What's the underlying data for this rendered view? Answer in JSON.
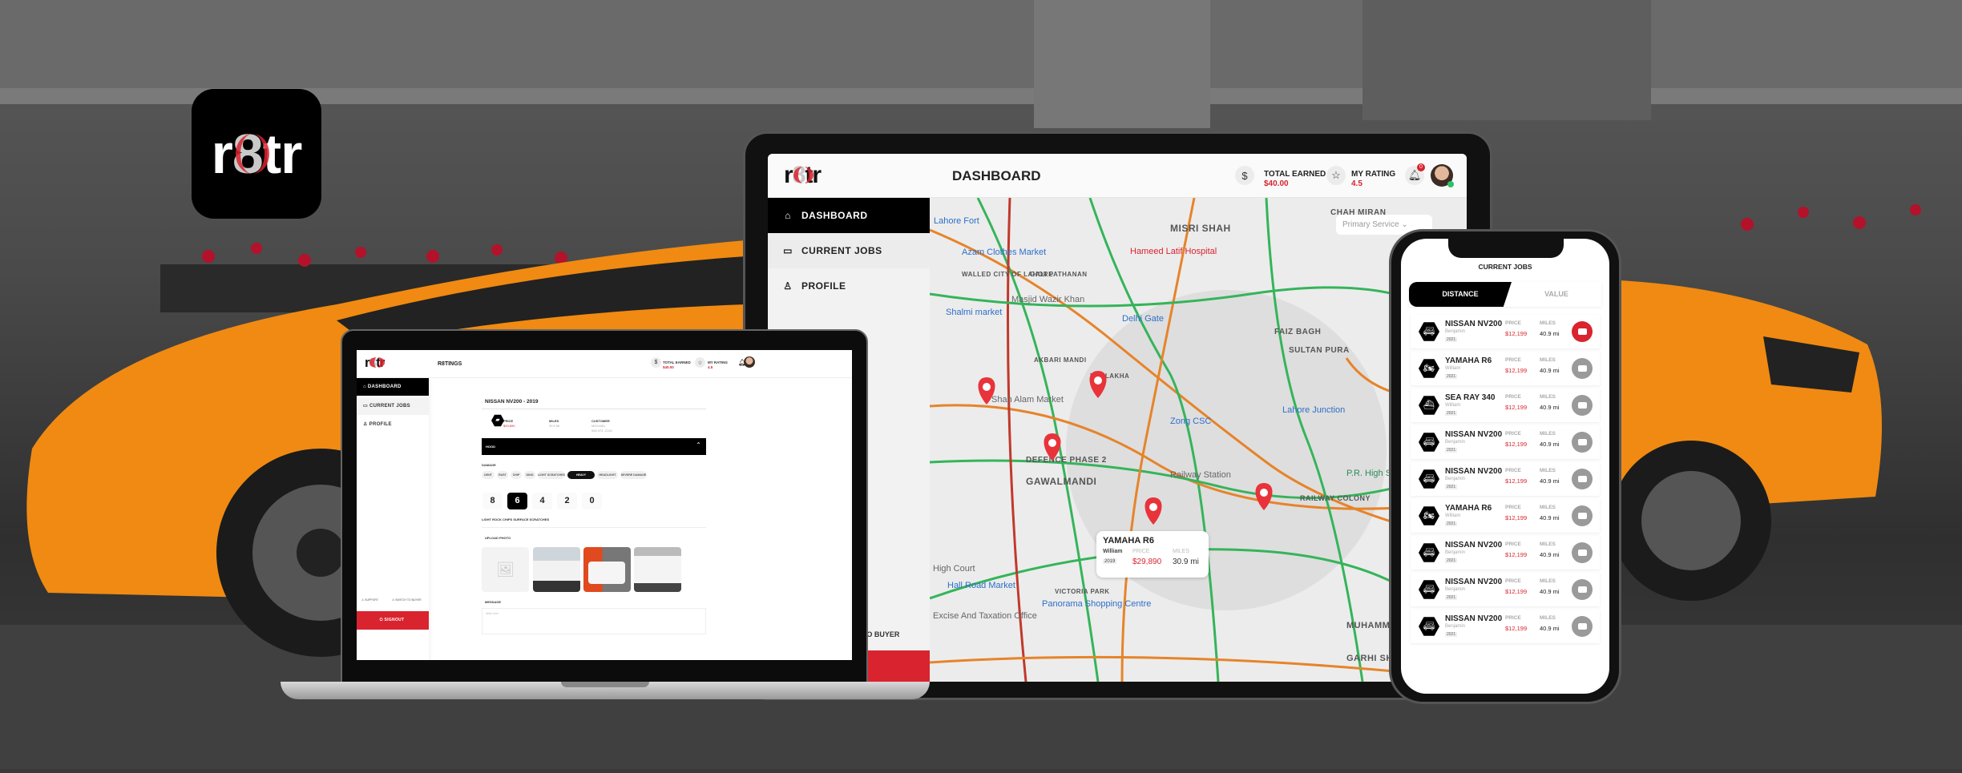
{
  "brand": {
    "logo_text": "r8tr",
    "accent": "#d9232e"
  },
  "tablet": {
    "page_title": "DASHBOARD",
    "total_earned_label": "TOTAL EARNED",
    "total_earned_value": "$40.00",
    "rating_label": "MY RATING",
    "rating_value": "4.5",
    "notification_count": "0",
    "sidebar": [
      {
        "label": "DASHBOARD",
        "icon": "home-icon"
      },
      {
        "label": "CURRENT JOBS",
        "icon": "briefcase-icon"
      },
      {
        "label": "PROFILE",
        "icon": "user-icon"
      }
    ],
    "switch_label": "SWITCH TO BUYER",
    "map": {
      "filter": "Primary Service",
      "labels": [
        "CHAH MIRAN",
        "MISRI SHAH",
        "Lahore Fort",
        "Azam Clothes Market",
        "Hameed Latif Hospital",
        "WALLED CITY OF LAHORE",
        "GALI PATHANAN",
        "Masjid Wazir Khan",
        "Shalmi market",
        "Delhi Gate",
        "FAIZ BAGH",
        "SULTAN PURA",
        "Shah Alam Market",
        "Lahore Junction",
        "Zong CSC",
        "DEFENCE PHASE 2",
        "GAWALMANDI",
        "Railway Station",
        "P.R. High School",
        "RAILWAY COLONY",
        "Hall Road Market",
        "High Court",
        "VICTORIA PARK",
        "Panorama Shopping Centre",
        "Excise And Taxation Office",
        "MUHAMMAD NAGAR",
        "GARHI SHAHU",
        "NAULAKHA",
        "AKBARI MANDI"
      ],
      "card": {
        "title": "YAMAHA R6",
        "customer": "William",
        "year": "2019",
        "price_label": "PRICE",
        "price": "$29,890",
        "miles_label": "MILES",
        "miles": "30.9 mi"
      }
    }
  },
  "laptop": {
    "page_title": "R8TINGS",
    "total_earned_label": "TOTAL EARNED",
    "total_earned_value": "$40.00",
    "rating_label": "MY RATING",
    "rating_value": "4.5",
    "sidebar": [
      {
        "label": "DASHBOARD"
      },
      {
        "label": "CURRENT JOBS"
      },
      {
        "label": "PROFILE"
      }
    ],
    "support_label": "SUPPORT",
    "switch_label": "SWITCH TO BUYER",
    "signout_label": "SIGNOUT",
    "vehicle_title": "NISSAN NV200 - 2019",
    "price_label": "PRICE",
    "price_value": "$29,890",
    "miles_label": "MILES",
    "miles_value": "30.9 MI",
    "customer_label": "CUSTOMER",
    "customer_name": "MICHAEL",
    "customer_phone": "568 374 -2140",
    "section": "HOOD",
    "damage_label": "DAMAGE",
    "damage_chips": [
      "DENT",
      "RUST",
      "CHIP",
      "DING",
      "LIGHT SCRATCHES",
      "HEAVY SCRATCHES",
      "HEADLIGHT",
      "SEVERE DAMAGE"
    ],
    "selected_chip": "HEAVY SCRATCHES",
    "scores": [
      "8",
      "6",
      "4",
      "2",
      "0"
    ],
    "selected_score": "6",
    "score_description": "LIGHT ROCK CHIPS SURFACE SCRATCHES",
    "upload_label": "UPLOAD PHOTO",
    "message_label": "MESSAGE",
    "message_placeholder": "Write here"
  },
  "phone": {
    "title": "CURRENT JOBS",
    "tabs": [
      "DISTANCE",
      "VALUE"
    ],
    "active_tab": "DISTANCE",
    "price_label": "PRICE",
    "miles_label": "MILES",
    "jobs": [
      {
        "name": "NISSAN NV200",
        "customer": "Benjamin",
        "year": "2021",
        "price": "$12,199",
        "miles": "40.9 mi",
        "icon": "van-icon",
        "active": true
      },
      {
        "name": "YAMAHA R6",
        "customer": "William",
        "year": "2021",
        "price": "$12,199",
        "miles": "40.9 mi",
        "icon": "motorcycle-icon"
      },
      {
        "name": "SEA RAY 340",
        "customer": "William",
        "year": "2021",
        "price": "$12,199",
        "miles": "40.9 mi",
        "icon": "boat-icon"
      },
      {
        "name": "NISSAN NV200",
        "customer": "Benjamin",
        "year": "2021",
        "price": "$12,199",
        "miles": "40.9 mi",
        "icon": "van-icon"
      },
      {
        "name": "NISSAN NV200",
        "customer": "Benjamin",
        "year": "2021",
        "price": "$12,199",
        "miles": "40.9 mi",
        "icon": "van-icon"
      },
      {
        "name": "YAMAHA R6",
        "customer": "William",
        "year": "2021",
        "price": "$12,199",
        "miles": "40.9 mi",
        "icon": "motorcycle-icon"
      },
      {
        "name": "NISSAN NV200",
        "customer": "Benjamin",
        "year": "2021",
        "price": "$12,199",
        "miles": "40.9 mi",
        "icon": "van-icon"
      },
      {
        "name": "NISSAN NV200",
        "customer": "Benjamin",
        "year": "2021",
        "price": "$12,199",
        "miles": "40.9 mi",
        "icon": "van-icon"
      },
      {
        "name": "NISSAN NV200",
        "customer": "Benjamin",
        "year": "2021",
        "price": "$12,199",
        "miles": "40.9 mi",
        "icon": "van-icon"
      }
    ]
  }
}
